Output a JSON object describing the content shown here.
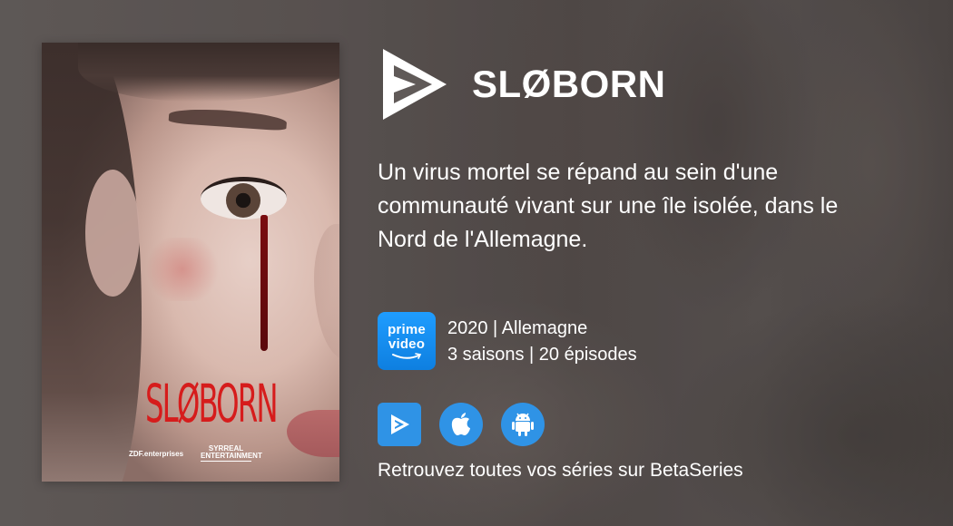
{
  "poster": {
    "title": "SLØBORN",
    "credit_left": "ZDF.enterprises",
    "credit_right": "SYRREAL ENTERTAINMENT"
  },
  "header": {
    "logo_icon": "betaseries-play-logo-icon",
    "title": "SLØBORN"
  },
  "synopsis": "Un virus mortel se répand au sein d'une communauté vivant sur une île isolée, dans le Nord de l'Allemagne.",
  "platform": {
    "icon": "prime-video-icon",
    "line1": "prime",
    "line2": "video",
    "color": "#1a98ff"
  },
  "meta": {
    "year_country": "2020 | Allemagne",
    "seasons_episodes": "3 saisons | 20 épisodes"
  },
  "stores": [
    {
      "icon": "betaseries-app-icon"
    },
    {
      "icon": "apple-icon"
    },
    {
      "icon": "android-icon"
    }
  ],
  "cta": "Retrouvez toutes vos séries sur BetaSeries",
  "colors": {
    "accent": "#2f93e6",
    "poster_title": "#d61c1c"
  }
}
